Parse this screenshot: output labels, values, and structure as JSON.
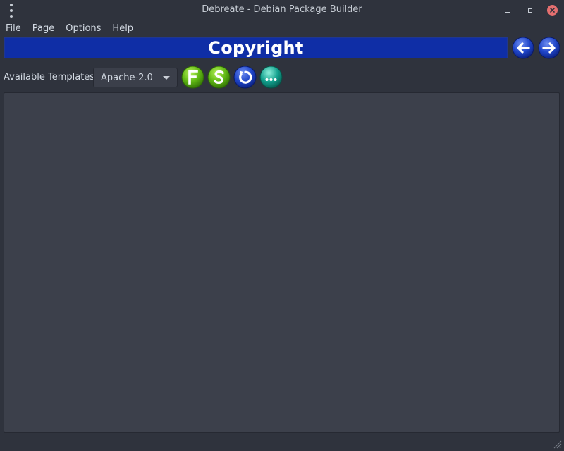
{
  "window": {
    "title": "Debreate - Debian Package Builder"
  },
  "menubar": {
    "items": [
      "File",
      "Page",
      "Options",
      "Help"
    ]
  },
  "banner": {
    "title": "Copyright"
  },
  "navigation": {
    "back_icon": "arrow-left-icon",
    "next_icon": "arrow-right-icon"
  },
  "toolbar": {
    "templates_label": "Available Templates",
    "template_selected": "Apache-2.0",
    "buttons": [
      {
        "icon": "full-template-icon",
        "glyph": "F",
        "color": "#5fb713"
      },
      {
        "icon": "short-template-icon",
        "glyph": "S",
        "color": "#5fb713"
      },
      {
        "icon": "refresh-icon",
        "color": "#1d3bb5"
      },
      {
        "icon": "more-icon",
        "color": "#12a08d"
      }
    ]
  },
  "editor": {
    "content": ""
  },
  "colors": {
    "background": "#2f333d",
    "banner": "#0f2ea6",
    "editor": "#3c404b",
    "close_button": "#e46f6f"
  }
}
